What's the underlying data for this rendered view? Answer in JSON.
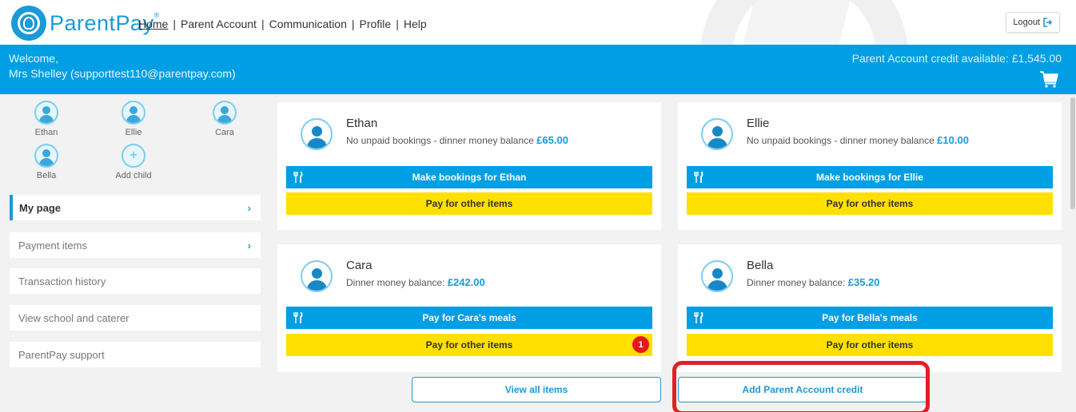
{
  "brand": {
    "name": "ParentPay",
    "reg": "®"
  },
  "nav": {
    "items": [
      {
        "label": "Home"
      },
      {
        "label": "Parent Account"
      },
      {
        "label": "Communication"
      },
      {
        "label": "Profile"
      },
      {
        "label": "Help"
      }
    ],
    "separator": "|"
  },
  "logout_label": "Logout",
  "welcome": {
    "line1": "Welcome,",
    "line2": "Mrs Shelley (supporttest110@parentpay.com)",
    "credit": "Parent Account credit available: £1,545.00"
  },
  "sidebar": {
    "children": [
      {
        "label": "Ethan"
      },
      {
        "label": "Ellie"
      },
      {
        "label": "Cara"
      },
      {
        "label": "Bella"
      },
      {
        "label": "Add child"
      }
    ],
    "menu": [
      {
        "label": "My page"
      },
      {
        "label": "Payment items"
      },
      {
        "label": "Transaction history"
      },
      {
        "label": "View school and caterer"
      },
      {
        "label": "ParentPay support"
      }
    ],
    "chevron": "›"
  },
  "cards": [
    {
      "name": "Ethan",
      "desc": "No unpaid bookings - dinner money balance ",
      "balance": "£65.00",
      "primary": "Make bookings for Ethan",
      "secondary": "Pay for other items"
    },
    {
      "name": "Ellie",
      "desc": "No unpaid bookings - dinner money balance ",
      "balance": "£10.00",
      "primary": "Make bookings for Ellie",
      "secondary": "Pay for other items"
    },
    {
      "name": "Cara",
      "desc": "Dinner money balance: ",
      "balance": "£242.00",
      "primary": "Pay for Cara's meals",
      "secondary": "Pay for other items",
      "badge": "1"
    },
    {
      "name": "Bella",
      "desc": "Dinner money balance: ",
      "balance": "£35.20",
      "primary": "Pay for Bella's meals",
      "secondary": "Pay for other items"
    }
  ],
  "actions": {
    "view_all": "View all items",
    "add_credit": "Add Parent Account credit"
  },
  "colors": {
    "brand_blue": "#009fe3",
    "yellow": "#ffe000",
    "highlight_red": "#e51d24",
    "badge_red": "#e4181b"
  }
}
